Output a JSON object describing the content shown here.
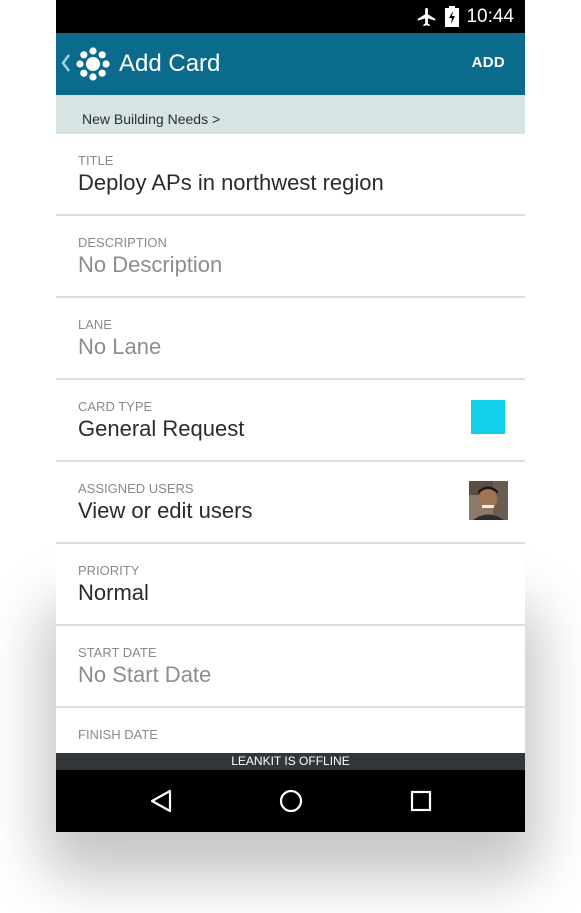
{
  "status_bar": {
    "time": "10:44"
  },
  "app_bar": {
    "title": "Add Card",
    "action": "ADD"
  },
  "breadcrumb": "New Building Needs >",
  "fields": [
    {
      "label": "TITLE",
      "value": "Deploy APs in northwest region"
    },
    {
      "label": "DESCRIPTION",
      "value": "No Description"
    },
    {
      "label": "LANE",
      "value": "No Lane"
    },
    {
      "label": "CARD TYPE",
      "value": "General Request",
      "swatch_color": "#12d0ea"
    },
    {
      "label": "ASSIGNED USERS",
      "value": "View or edit users"
    },
    {
      "label": "PRIORITY",
      "value": "Normal"
    },
    {
      "label": "START DATE",
      "value": "No Start Date"
    },
    {
      "label": "FINISH DATE",
      "value": ""
    }
  ],
  "offline_banner": "LEANKIT IS OFFLINE",
  "colors": {
    "app_bar": "#0b6b8c",
    "breadcrumb_bg": "#d7e4e4"
  },
  "icons": [
    "airplane-icon",
    "battery-icon",
    "back-chevron-icon",
    "leankit-logo-icon",
    "nav-back-icon",
    "nav-home-icon",
    "nav-recents-icon"
  ]
}
